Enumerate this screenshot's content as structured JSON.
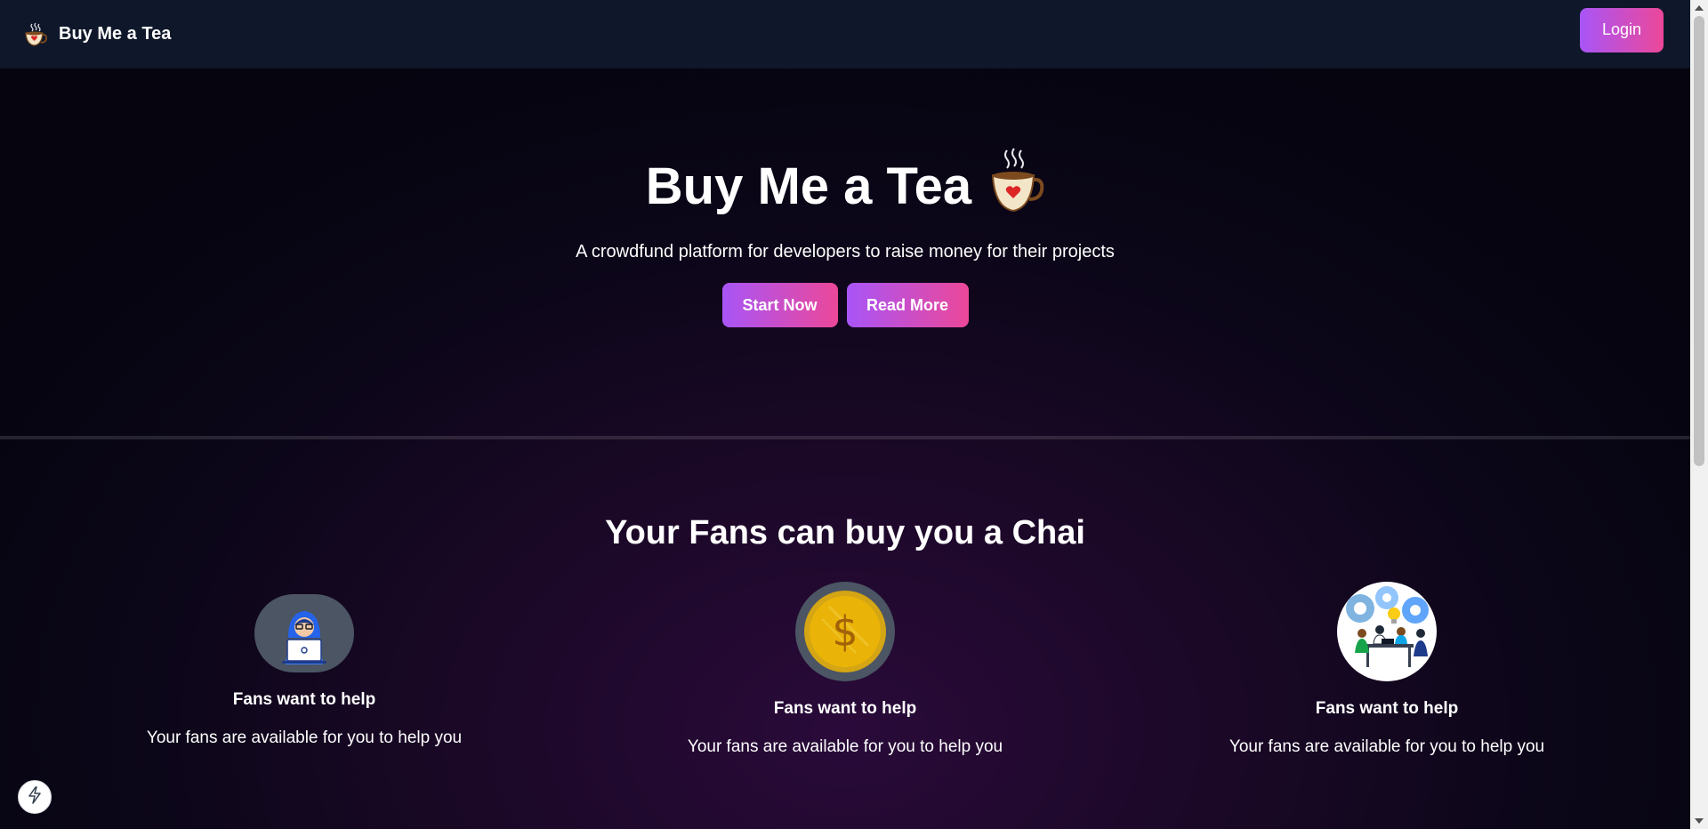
{
  "navbar": {
    "brand": "Buy Me a Tea",
    "brand_icon": "tea-cup-icon",
    "login_label": "Login"
  },
  "hero": {
    "title": "Buy Me a Tea",
    "title_icon": "steaming-tea-cup-icon",
    "subtitle": "A crowdfund platform for developers to raise money for their projects",
    "start_label": "Start Now",
    "read_label": "Read More"
  },
  "features": {
    "title": "Your Fans can buy you a Chai",
    "items": [
      {
        "icon": "developer-laptop-icon",
        "title": "Fans want to help",
        "text": "Your fans are available for you to help you"
      },
      {
        "icon": "gold-coin-icon",
        "title": "Fans want to help",
        "text": "Your fans are available for you to help you"
      },
      {
        "icon": "team-collaboration-icon",
        "title": "Fans want to help",
        "text": "Your fans are available for you to help you"
      }
    ]
  },
  "colors": {
    "accent_start": "#a855f7",
    "accent_end": "#ec4899",
    "navbar_bg": "#0f172a",
    "page_bg": "#05040f"
  },
  "dev_badge_icon": "lightning-icon"
}
